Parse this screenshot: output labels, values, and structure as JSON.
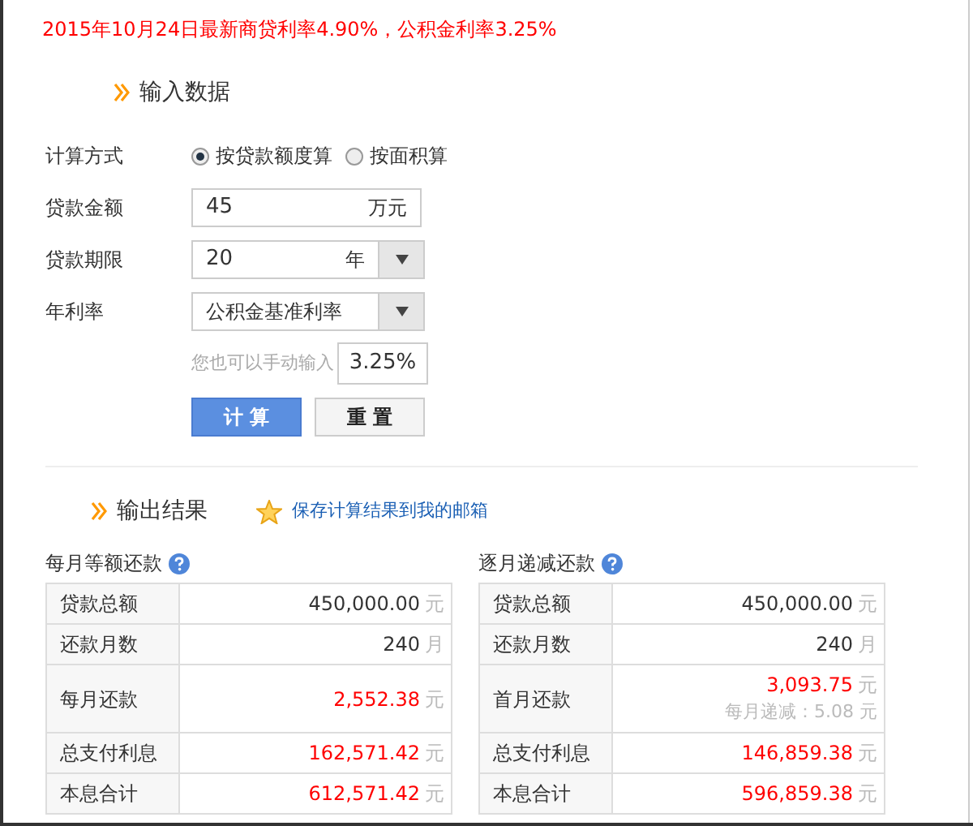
{
  "notice": "2015年10月24日最新商贷利率4.90%，公积金利率3.25%",
  "input_section": {
    "title": "输入数据",
    "method": {
      "label": "计算方式",
      "options": [
        {
          "label": "按贷款额度算",
          "selected": true
        },
        {
          "label": "按面积算",
          "selected": false
        }
      ]
    },
    "amount": {
      "label": "贷款金额",
      "value": "45",
      "unit": "万元"
    },
    "term": {
      "label": "贷款期限",
      "value": "20",
      "unit": "年"
    },
    "rate": {
      "label": "年利率",
      "value": "公积金基准利率"
    },
    "manual": {
      "hint": "您也可以手动输入",
      "value": "3.25%"
    },
    "buttons": [
      {
        "label": "计 算",
        "kind": "primary"
      },
      {
        "label": "重 置",
        "kind": "secondary"
      }
    ]
  },
  "output_section": {
    "title": "输出结果",
    "save_link": "保存计算结果到我的邮箱",
    "tables": [
      {
        "title": "每月等额还款",
        "rows": [
          {
            "label": "贷款总额",
            "value": "450,000.00",
            "unit": "元",
            "highlight": false
          },
          {
            "label": "还款月数",
            "value": "240",
            "unit": "月",
            "highlight": false
          },
          {
            "label": "每月还款",
            "value": "2,552.38",
            "unit": "元",
            "highlight": true,
            "tall": true
          },
          {
            "label": "总支付利息",
            "value": "162,571.42",
            "unit": "元",
            "highlight": true
          },
          {
            "label": "本息合计",
            "value": "612,571.42",
            "unit": "元",
            "highlight": true
          }
        ]
      },
      {
        "title": "逐月递减还款",
        "rows": [
          {
            "label": "贷款总额",
            "value": "450,000.00",
            "unit": "元",
            "highlight": false
          },
          {
            "label": "还款月数",
            "value": "240",
            "unit": "月",
            "highlight": false
          },
          {
            "label": "首月还款",
            "value": "3,093.75",
            "unit": "元",
            "highlight": true,
            "tall": true,
            "note": "每月递减：5.08 元"
          },
          {
            "label": "总支付利息",
            "value": "146,859.38",
            "unit": "元",
            "highlight": true
          },
          {
            "label": "本息合计",
            "value": "596,859.38",
            "unit": "元",
            "highlight": true
          }
        ]
      }
    ]
  }
}
